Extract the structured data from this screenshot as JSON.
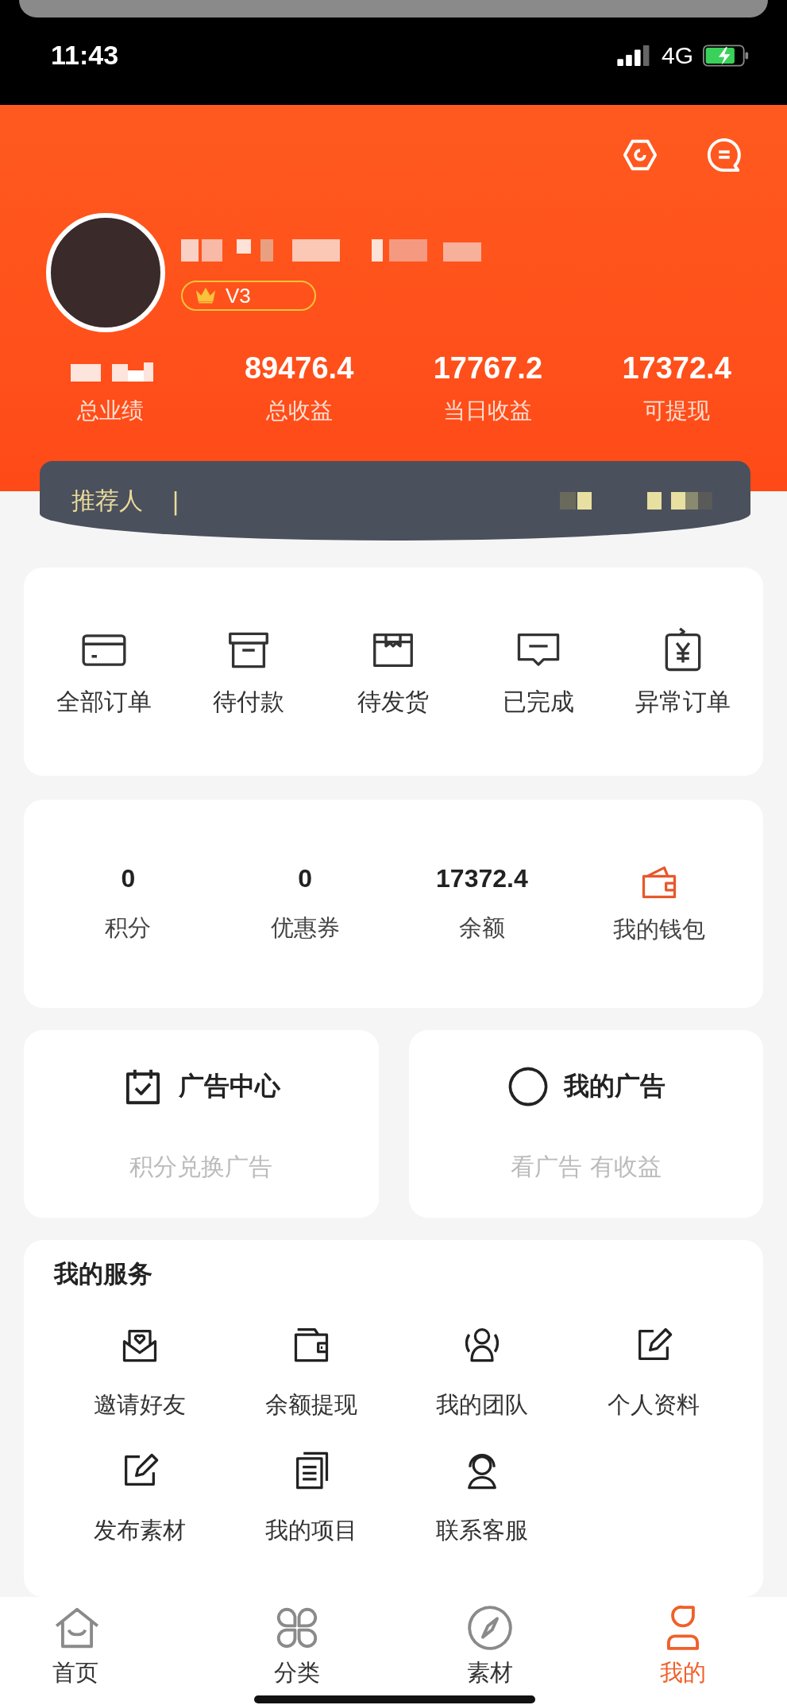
{
  "status_bar": {
    "time": "11:43",
    "network": "4G"
  },
  "header": {
    "badge": "V3",
    "stats": [
      {
        "label": "总业绩"
      },
      {
        "value": "89476.4",
        "label": "总收益"
      },
      {
        "value": "17767.2",
        "label": "当日收益"
      },
      {
        "value": "17372.4",
        "label": "可提现"
      }
    ],
    "referrer": {
      "label": "推荐人",
      "separator": "|"
    }
  },
  "orders": [
    {
      "label": "全部订单",
      "kind": "card"
    },
    {
      "label": "待付款",
      "kind": "box"
    },
    {
      "label": "待发货",
      "kind": "package"
    },
    {
      "label": "已完成",
      "kind": "chat"
    },
    {
      "label": "异常订单",
      "kind": "yen"
    }
  ],
  "wallet": [
    {
      "kind": "value",
      "value": "0",
      "label": "积分"
    },
    {
      "kind": "value",
      "value": "0",
      "label": "优惠券"
    },
    {
      "kind": "value",
      "value": "17372.4",
      "label": "余额"
    },
    {
      "kind": "wallet",
      "label": "我的钱包"
    }
  ],
  "ads": [
    {
      "kind": "calendar",
      "title": "广告中心",
      "subtitle": "积分兑换广告"
    },
    {
      "kind": "circle",
      "title": "我的广告",
      "subtitle": "看广告 有收益"
    }
  ],
  "services": {
    "title": "我的服务",
    "items": [
      {
        "label": "邀请好友",
        "kind": "envelope"
      },
      {
        "label": "余额提现",
        "kind": "purse"
      },
      {
        "label": "我的团队",
        "kind": "team"
      },
      {
        "label": "个人资料",
        "kind": "edit"
      },
      {
        "label": "发布素材",
        "kind": "edit"
      },
      {
        "label": "我的项目",
        "kind": "documents"
      },
      {
        "label": "联系客服",
        "kind": "headset"
      }
    ]
  },
  "nav": [
    {
      "label": "首页",
      "kind": "home",
      "selected": false
    },
    {
      "label": "分类",
      "kind": "clover",
      "selected": false
    },
    {
      "label": "素材",
      "kind": "compass",
      "selected": false
    },
    {
      "label": "我的",
      "kind": "person",
      "selected": true
    }
  ]
}
